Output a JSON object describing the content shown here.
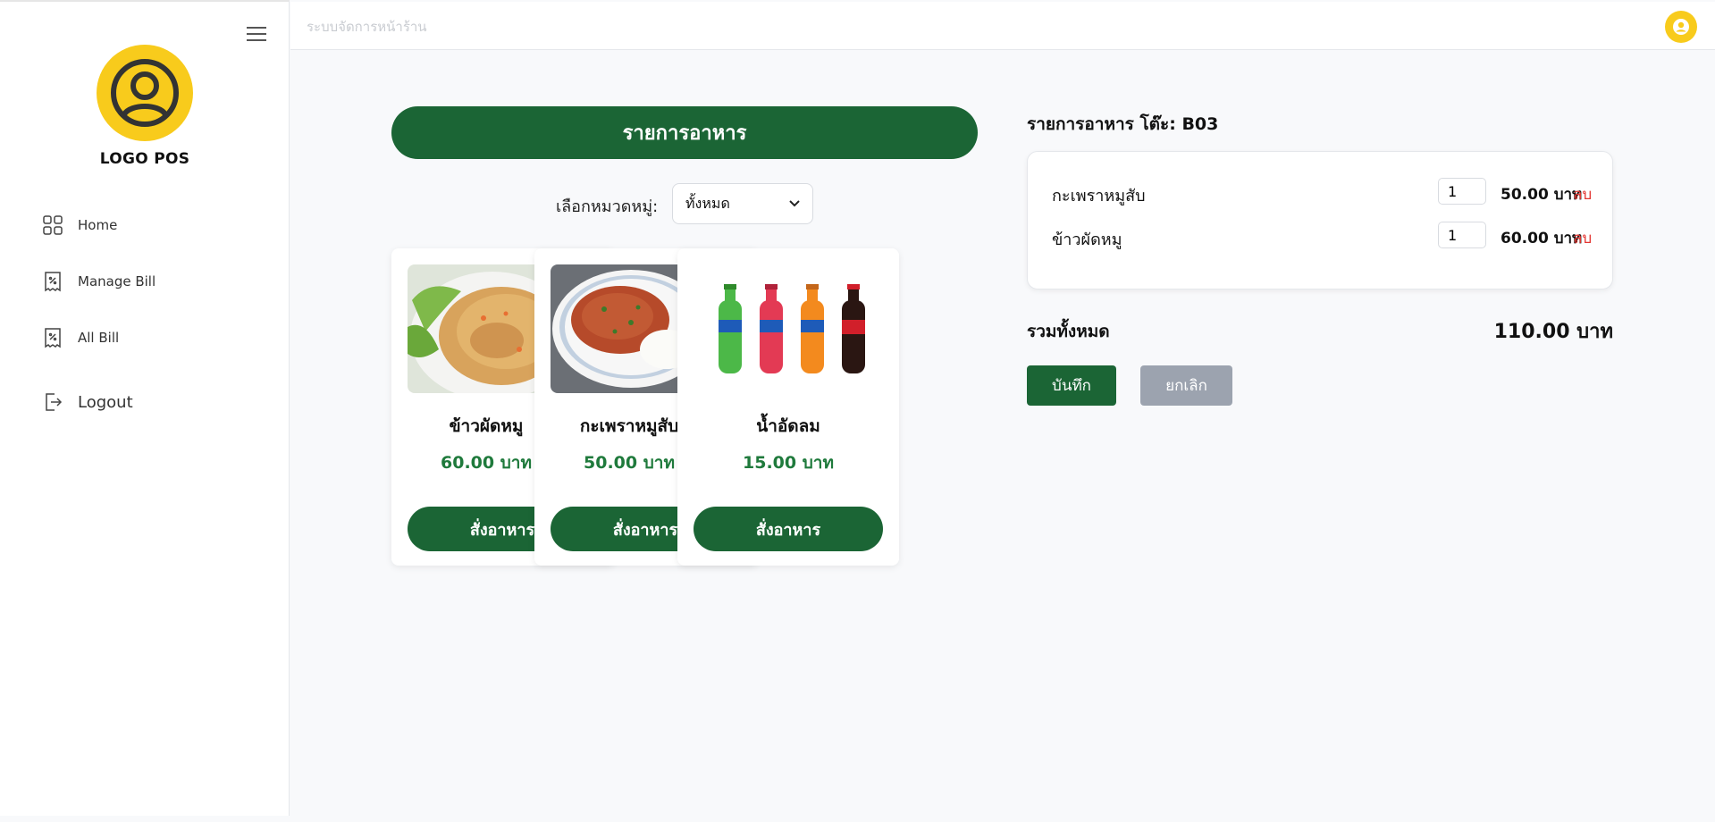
{
  "sidebar": {
    "logo_text": "LOGO POS",
    "items": [
      {
        "label": "Home",
        "icon": "grid-icon"
      },
      {
        "label": "Manage Bill",
        "icon": "receipt-icon"
      },
      {
        "label": "All Bill",
        "icon": "receipt-icon"
      },
      {
        "label": "Logout",
        "icon": "logout-icon"
      }
    ]
  },
  "topbar": {
    "title": "ระบบจัดการหน้าร้าน"
  },
  "menu": {
    "header": "รายการอาหาร",
    "category_label": "เลือกหมวดหมู่:",
    "category_selected": "ทั้งหมด",
    "items": [
      {
        "name": "ข้าวผัดหมู",
        "price": "60.00 บาท",
        "button": "สั่งอาหาร"
      },
      {
        "name": "กะเพราหมูสับ",
        "price": "50.00 บาท",
        "button": "สั่งอาหาร"
      },
      {
        "name": "น้ำอัดลม",
        "price": "15.00 บาท",
        "button": "สั่งอาหาร"
      }
    ]
  },
  "order": {
    "title": "รายการอาหาร โต๊ะ: B03",
    "items": [
      {
        "name": "กะเพราหมูสับ",
        "qty": "1",
        "price": "50.00 บาท",
        "delete": "ลบ"
      },
      {
        "name": "ข้าวผัดหมู",
        "qty": "1",
        "price": "60.00 บาท",
        "delete": "ลบ"
      }
    ],
    "total_label": "รวมทั้งหมด",
    "total_value": "110.00 บาท",
    "save_label": "บันทึก",
    "cancel_label": "ยกเลิก"
  },
  "colors": {
    "primary": "#1b6535",
    "accent": "#f8cb1c",
    "price": "#1f7a3c",
    "danger": "#e3342f",
    "cancel": "#9ca3af"
  }
}
